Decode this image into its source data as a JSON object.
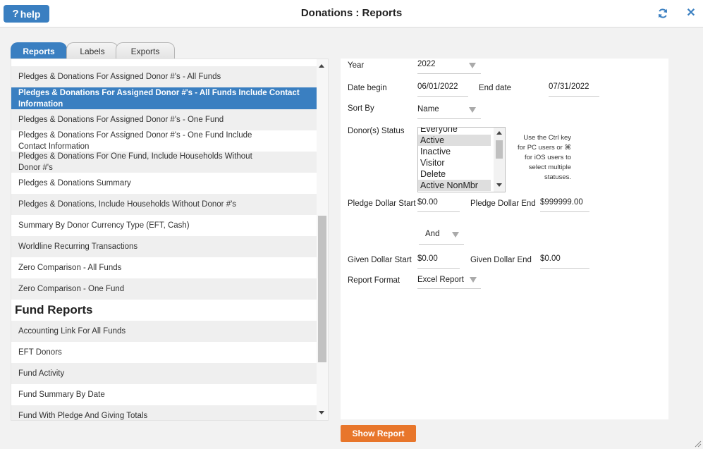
{
  "window": {
    "title": "Donations : Reports",
    "help_label": "help",
    "help_glyph": "?",
    "close_glyph": "✕"
  },
  "tabs": [
    {
      "label": "Reports",
      "active": true
    },
    {
      "label": "Labels",
      "active": false
    },
    {
      "label": "Exports",
      "active": false
    }
  ],
  "reports_list": [
    {
      "label": "Pledges & Donations For Assigned Donor #'s - All Funds",
      "state": "alt"
    },
    {
      "label": "Pledges & Donations For Assigned Donor #'s - All Funds Include Contact Information",
      "state": "selected"
    },
    {
      "label": "Pledges & Donations For Assigned Donor #'s - One Fund",
      "state": "alt"
    },
    {
      "label": "Pledges & Donations For Assigned Donor #'s - One Fund Include Contact Information",
      "state": "plain"
    },
    {
      "label": "Pledges & Donations For One Fund, Include Households Without Donor #'s",
      "state": "alt"
    },
    {
      "label": "Pledges & Donations Summary",
      "state": "plain"
    },
    {
      "label": "Pledges & Donations, Include Households Without Donor #'s",
      "state": "alt"
    },
    {
      "label": "Summary By Donor Currency Type (EFT, Cash)",
      "state": "plain"
    },
    {
      "label": "Worldline Recurring Transactions",
      "state": "alt"
    },
    {
      "label": "Zero Comparison - All Funds",
      "state": "plain"
    },
    {
      "label": "Zero Comparison - One Fund",
      "state": "alt"
    },
    {
      "label": "Fund Reports",
      "state": "heading"
    },
    {
      "label": "Accounting Link For All Funds",
      "state": "alt"
    },
    {
      "label": "EFT Donors",
      "state": "plain"
    },
    {
      "label": "Fund Activity",
      "state": "alt"
    },
    {
      "label": "Fund Summary By Date",
      "state": "plain"
    },
    {
      "label": "Fund With Pledge And Giving Totals",
      "state": "alt"
    }
  ],
  "form": {
    "year_label": "Year",
    "year_value": "2022",
    "date_begin_label": "Date begin",
    "date_begin_value": "06/01/2022",
    "end_date_label": "End date",
    "end_date_value": "07/31/2022",
    "sort_by_label": "Sort By",
    "sort_by_value": "Name",
    "donor_status_label": "Donor(s) Status",
    "donor_status_options": [
      {
        "label": "Everyone",
        "selected": false
      },
      {
        "label": "Active",
        "selected": true
      },
      {
        "label": "Inactive",
        "selected": false
      },
      {
        "label": "Visitor",
        "selected": false
      },
      {
        "label": "Delete",
        "selected": false
      },
      {
        "label": "Active NonMbr",
        "selected": true
      }
    ],
    "multi_select_hint": [
      "Use the Ctrl key",
      "for PC users or ⌘",
      "for iOS users to",
      "select multiple",
      "statuses."
    ],
    "pledge_start_label": "Pledge Dollar Start",
    "pledge_start_value": "$0.00",
    "pledge_end_label": "Pledge Dollar End",
    "pledge_end_value": "$999999.00",
    "conjunction_value": "And",
    "given_start_label": "Given Dollar Start",
    "given_start_value": "$0.00",
    "given_end_label": "Given Dollar End",
    "given_end_value": "$0.00",
    "report_format_label": "Report Format",
    "report_format_value": "Excel Report"
  },
  "actions": {
    "show_report_label": "Show Report"
  },
  "colors": {
    "accent_blue": "#3a7fc1",
    "button_orange": "#e8762b"
  }
}
